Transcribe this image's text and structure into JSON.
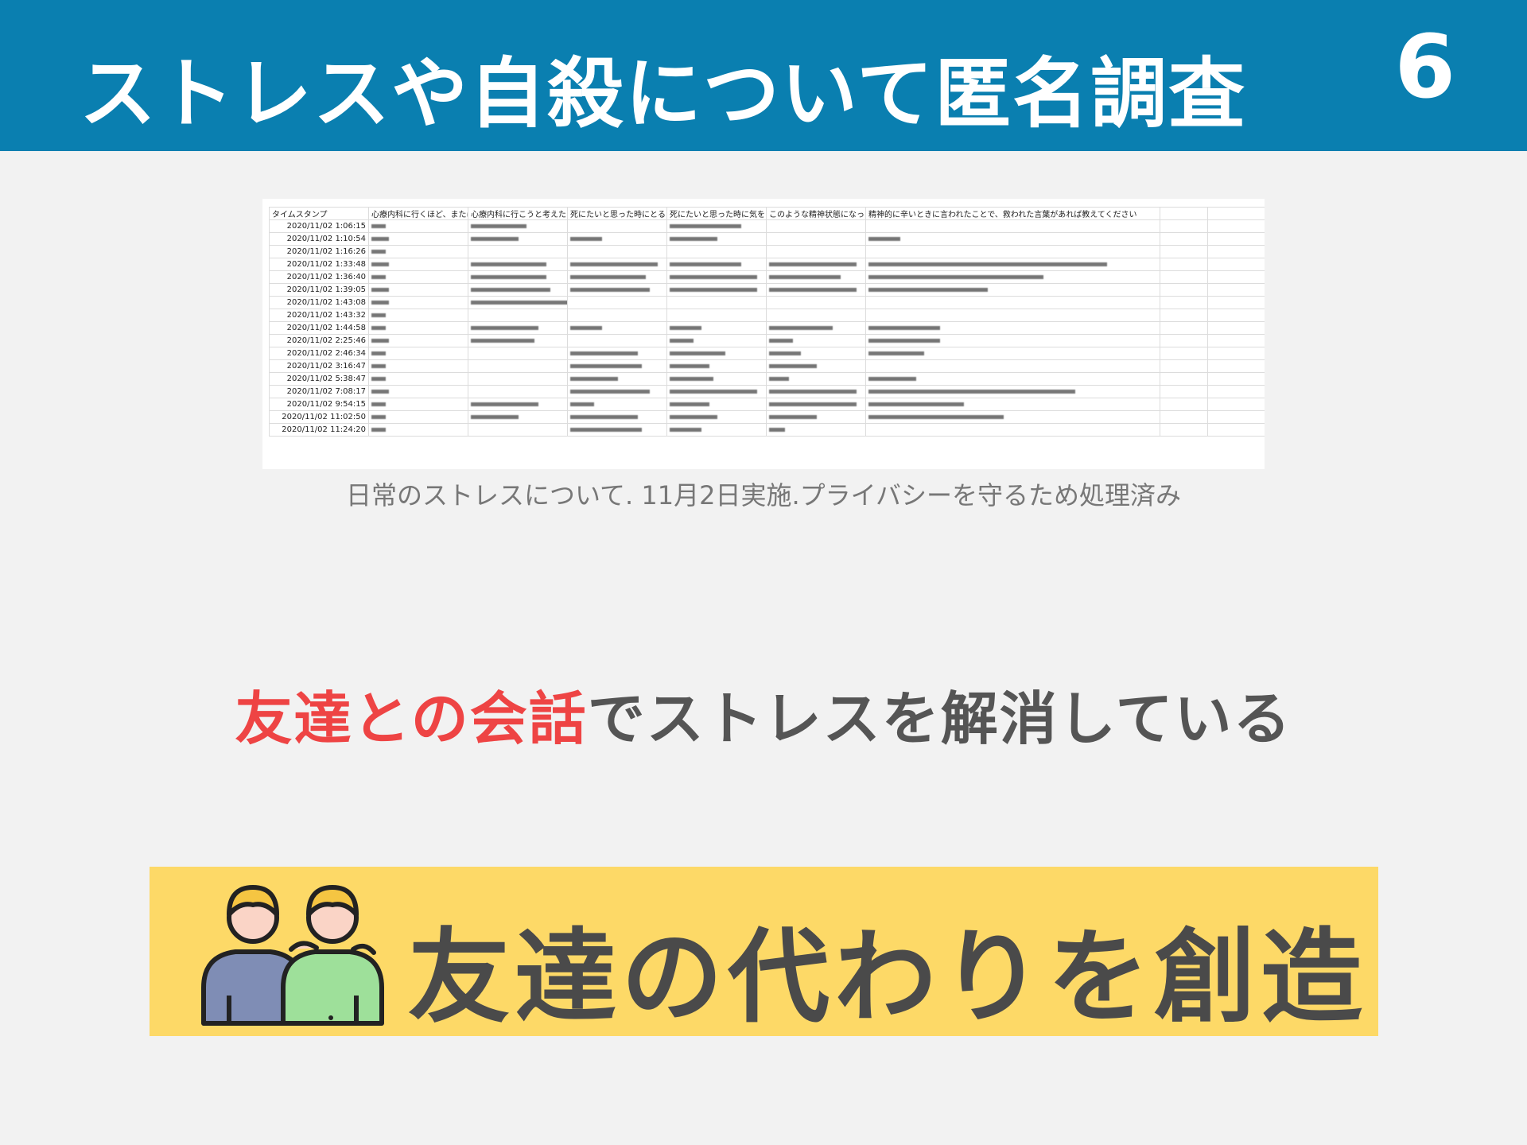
{
  "header": {
    "title": "ストレスや自殺について匿名調査",
    "page_number": "6"
  },
  "survey_sheet": {
    "columns": [
      "タイムスタンプ",
      "心療内科に行くほど、または",
      "心療内科に行こうと考えた",
      "死にたいと思った時にとる",
      "死にたいと思った時に気を",
      "このような精神状態になっ",
      "精神的に辛いときに言われたことで、救われた言葉があれば教えてください",
      "",
      ""
    ],
    "timestamps": [
      "2020/11/02 1:06:15",
      "2020/11/02 1:10:54",
      "2020/11/02 1:16:26",
      "2020/11/02 1:33:48",
      "2020/11/02 1:36:40",
      "2020/11/02 1:39:05",
      "2020/11/02 1:43:08",
      "2020/11/02 1:43:32",
      "2020/11/02 1:44:58",
      "2020/11/02 2:25:46",
      "2020/11/02 2:46:34",
      "2020/11/02 3:16:47",
      "2020/11/02 5:38:47",
      "2020/11/02 7:08:17",
      "2020/11/02 9:54:15",
      "2020/11/02 11:02:50",
      "2020/11/02 11:24:20"
    ]
  },
  "caption": "日常のストレスについて. 11月2日実施.プライバシーを守るため処理済み",
  "finding": {
    "highlight": "友達との会話",
    "rest": "でストレスを解消している"
  },
  "banner": {
    "icon": "two-friends-icon",
    "text": "友達の代わりを創造"
  },
  "colors": {
    "header_bg": "#0a7fb0",
    "accent_red": "#ee4444",
    "banner_bg": "#fdd967",
    "text_dark": "#4a4a4a"
  }
}
